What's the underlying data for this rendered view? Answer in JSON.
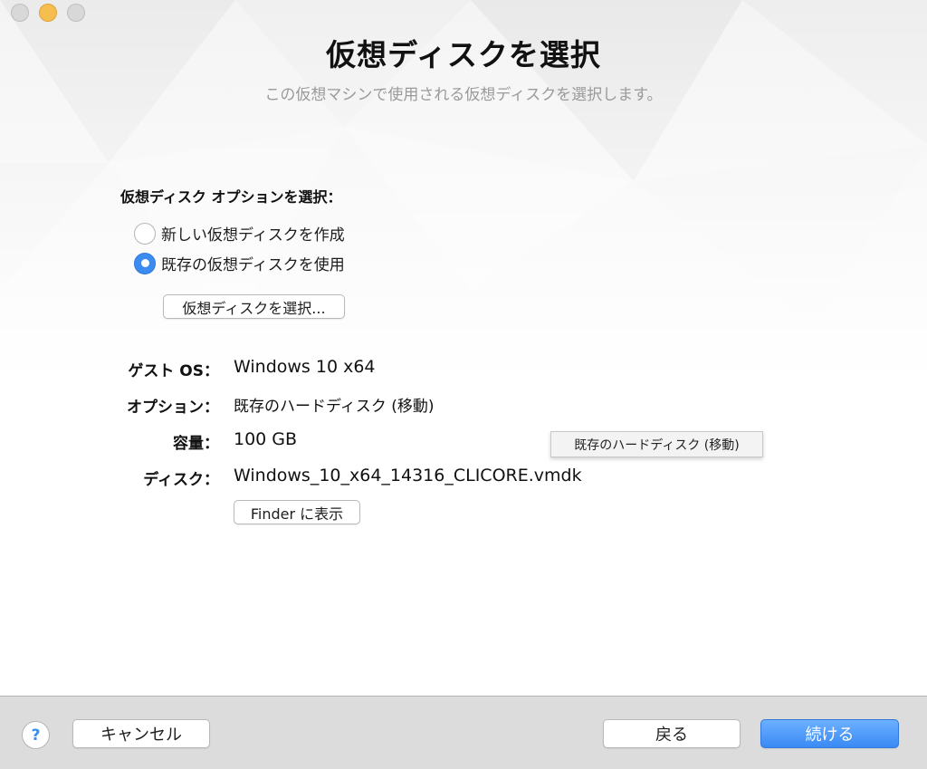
{
  "window": {
    "title": "仮想ディスクを選択",
    "subtitle": "この仮想マシンで使用される仮想ディスクを選択します。"
  },
  "options": {
    "label": "仮想ディスク オプションを選択：",
    "radio_new": "新しい仮想ディスクを作成",
    "radio_existing": "既存の仮想ディスクを使用",
    "selected": "既存の仮想ディスクを使用",
    "select_button": "仮想ディスクを選択..."
  },
  "info": {
    "guest_os_label": "ゲスト OS：",
    "guest_os_value": "Windows 10 x64",
    "option_label": "オプション：",
    "option_value": "既存のハードディスク (移動)",
    "capacity_label": "容量：",
    "capacity_value": "100 GB",
    "disk_label": "ディスク：",
    "disk_value": "Windows_10_x64_14316_CLICORE.vmdk",
    "finder_button": "Finder に表示"
  },
  "tooltip": {
    "text": "既存のハードディスク (移動)"
  },
  "footer": {
    "help": "?",
    "cancel": "キャンセル",
    "back": "戻る",
    "continue": "続ける"
  },
  "colors": {
    "accent": "#3b8bf0",
    "minimize": "#f6be4f",
    "footer_bg": "#dcdcdc"
  }
}
